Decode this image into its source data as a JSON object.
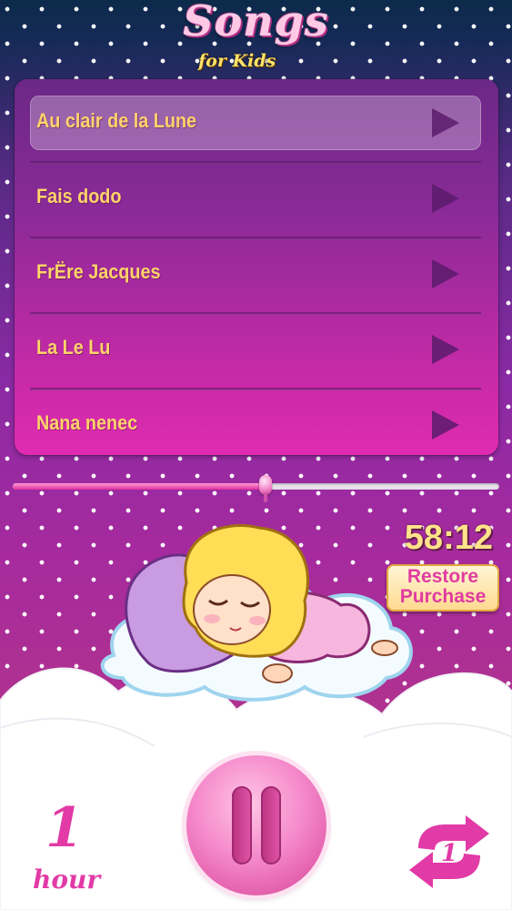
{
  "app": {
    "title": "Songs",
    "subtitle": "for Kids"
  },
  "songs": [
    {
      "label": "Au clair de la Lune",
      "selected": true
    },
    {
      "label": "Fais dodo",
      "selected": false
    },
    {
      "label": "FrËre Jacques",
      "selected": false
    },
    {
      "label": "La Le Lu",
      "selected": false
    },
    {
      "label": "Nana nenec",
      "selected": false
    }
  ],
  "player": {
    "progress": 0.52,
    "timer": "58:12",
    "state": "playing"
  },
  "restore": {
    "line1": "Restore",
    "line2": "Purchase"
  },
  "sleep_timer": {
    "number": "1",
    "unit": "hour"
  },
  "repeat": {
    "mode": "1"
  },
  "icons": {
    "play": "play-icon",
    "pause": "pause-icon",
    "repeat": "repeat-one-icon"
  },
  "colors": {
    "accent_pink": "#e23aa6",
    "label_yellow": "#ffd36b"
  }
}
